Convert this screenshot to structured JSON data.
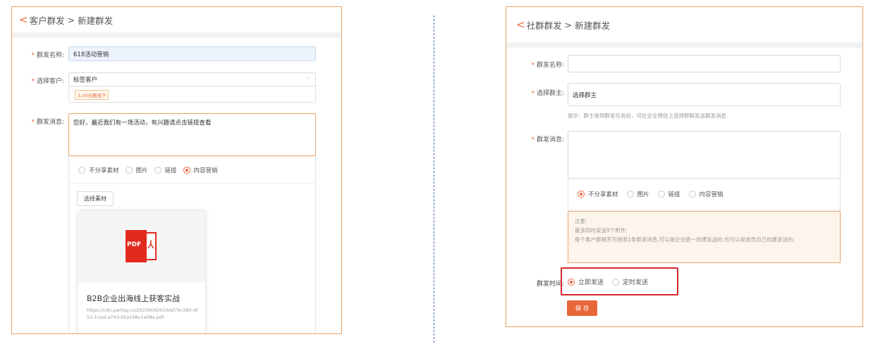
{
  "left": {
    "breadcrumb": {
      "back_glyph": "<",
      "parent": "客户群发",
      "separator": ">",
      "current": "新建群发"
    },
    "fields": {
      "name": {
        "required": "*",
        "label": "群发名称:",
        "value": "618活动营销"
      },
      "customer": {
        "required": "*",
        "label": "选择客户:",
        "value": "标签客户",
        "tag": "3.30谷歌线下"
      },
      "message": {
        "required": "*",
        "label": "群发消息:",
        "value": "您好，最近我们有一场活动，有兴趣请点击链接查看"
      }
    },
    "attachment_options": [
      {
        "label": "不分享素材",
        "selected": false
      },
      {
        "label": "图片",
        "selected": false
      },
      {
        "label": "链接",
        "selected": false
      },
      {
        "label": "内容营销",
        "selected": true
      }
    ],
    "choose_material_label": "选择素材",
    "material_card": {
      "icon": "pdf-file-icon",
      "icon_text": "PDF",
      "title": "B2B企业出海线上获客实战",
      "url": "https://cdn.parllay.cn/20230042016/ef79c280-df52-11ed-a743-95a198c1e08a.pdf"
    }
  },
  "right": {
    "breadcrumb": {
      "back_glyph": "<",
      "parent": "社群群发",
      "separator": ">",
      "current": "新建群发"
    },
    "fields": {
      "name": {
        "required": "*",
        "label": "群发名称:",
        "value": ""
      },
      "owner": {
        "required": "*",
        "label": "选择群主:",
        "value": "选择群主",
        "hint": "提示：群主收到群发任务后，可在企业微信上选择群聊发送群发消息"
      },
      "message": {
        "required": "*",
        "label": "群发消息:",
        "value": ""
      }
    },
    "attachment_options": [
      {
        "label": "不分享素材",
        "selected": true
      },
      {
        "label": "图片",
        "selected": false
      },
      {
        "label": "链接",
        "selected": false
      },
      {
        "label": "内容营销",
        "selected": false
      }
    ],
    "notice": {
      "title": "注意:",
      "line1": "最多同时发送9个附件;",
      "line2": "每个客户群每天可接收1条群发消息,可以是企业统一创建发送的,也可以是成员自己创建发送的;"
    },
    "send_time": {
      "label": "群发时间:",
      "options": [
        {
          "label": "立即发送",
          "selected": true
        },
        {
          "label": "定时发送",
          "selected": false
        }
      ]
    },
    "save_label": "保 存"
  },
  "colors": {
    "accent": "#e8673a",
    "panel_border": "#e9a36a",
    "highlight_box": "#d7262a",
    "divider": "#4b6fa8"
  }
}
